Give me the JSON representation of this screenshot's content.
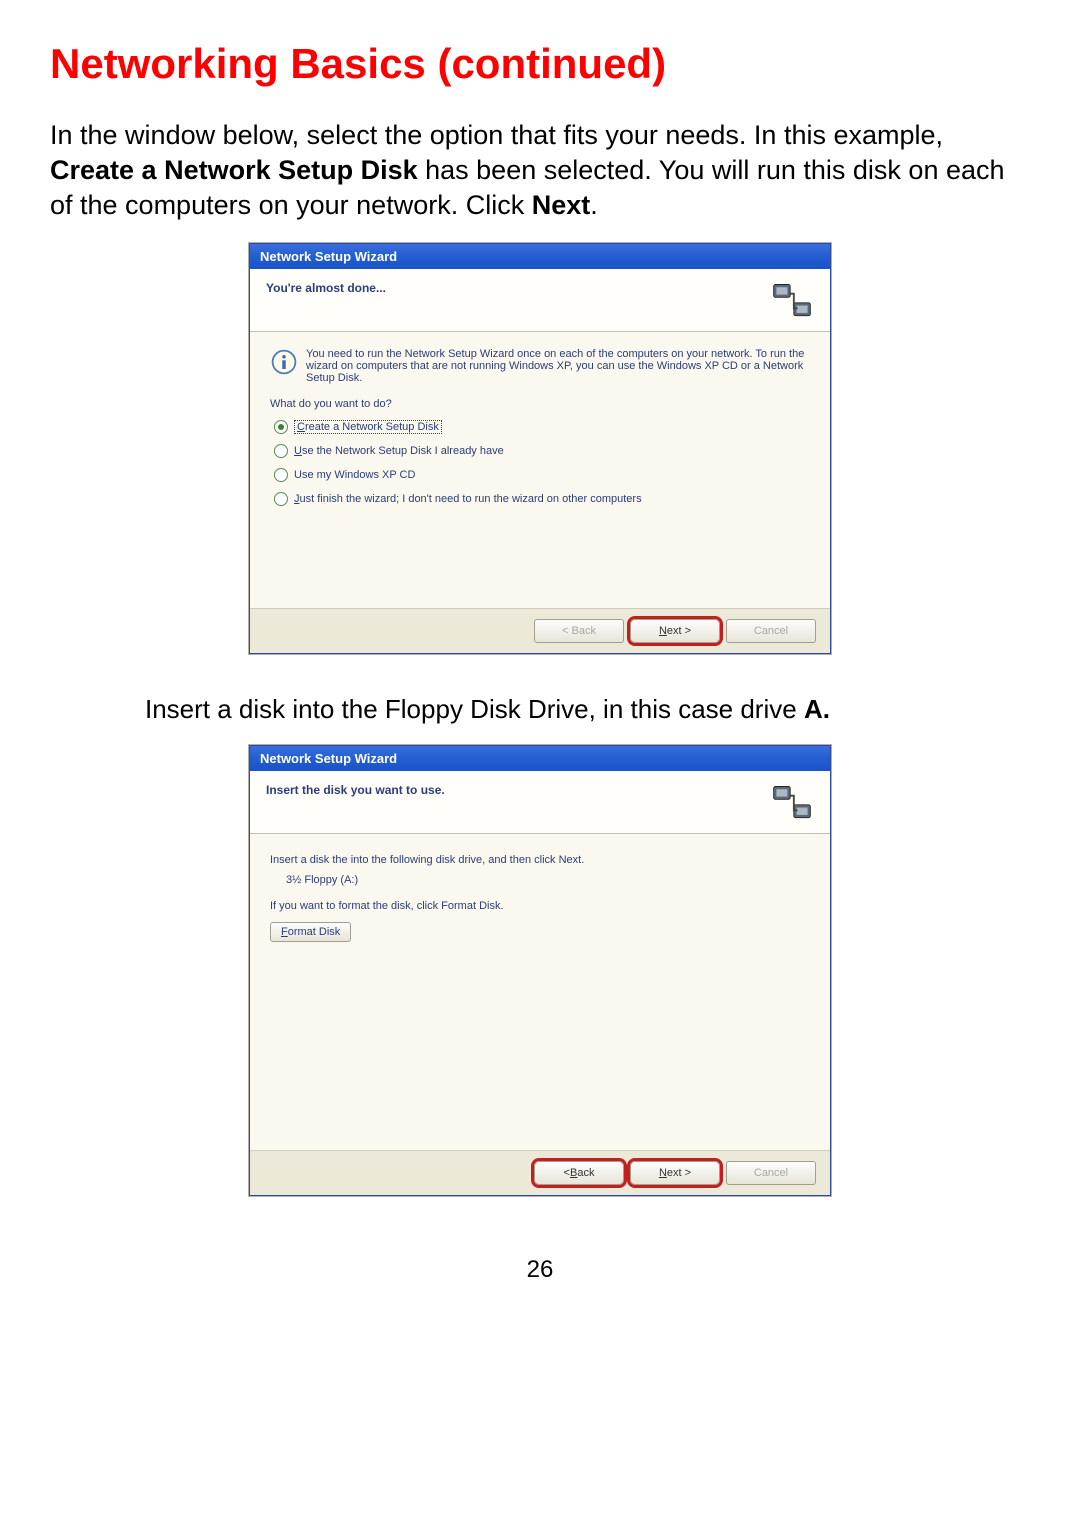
{
  "page": {
    "title": "Networking Basics (continued)",
    "intro_pre": "In the window below, select the option that fits your needs. In this example, ",
    "intro_bold1": "Create a Network Setup Disk",
    "intro_mid": " has been selected. You will run this disk on each of the computers on your network. Click ",
    "intro_bold2": "Next",
    "intro_end": ".",
    "mid_text_pre": "Insert a disk into the Floppy Disk Drive, in this case drive ",
    "mid_text_bold": "A.",
    "page_number": "26"
  },
  "wizard1": {
    "title": "Network Setup Wizard",
    "header": "You're almost done...",
    "info_text": "You need to run the Network Setup Wizard once on each of the computers on your network. To run the wizard on computers that are not running Windows XP, you can use the Windows XP CD or a Network Setup Disk.",
    "prompt": "What do you want to do?",
    "options": [
      {
        "label": "Create a Network Setup Disk",
        "selected": true
      },
      {
        "label": "Use the Network Setup Disk I already have",
        "selected": false
      },
      {
        "label": "Use my Windows XP CD",
        "selected": false
      },
      {
        "label": "Just finish the wizard; I don't need to run the wizard on other computers",
        "selected": false
      }
    ],
    "buttons": {
      "back": "< Back",
      "next": "Next >",
      "cancel": "Cancel"
    }
  },
  "wizard2": {
    "title": "Network Setup Wizard",
    "header": "Insert the disk you want to use.",
    "line1": "Insert a disk the into the following disk drive, and then click Next.",
    "drive": "3½ Floppy (A:)",
    "line2": "If you want to format the disk, click Format Disk.",
    "format_btn": "Format Disk",
    "buttons": {
      "back": "< Back",
      "next": "Next >",
      "cancel": "Cancel"
    }
  }
}
